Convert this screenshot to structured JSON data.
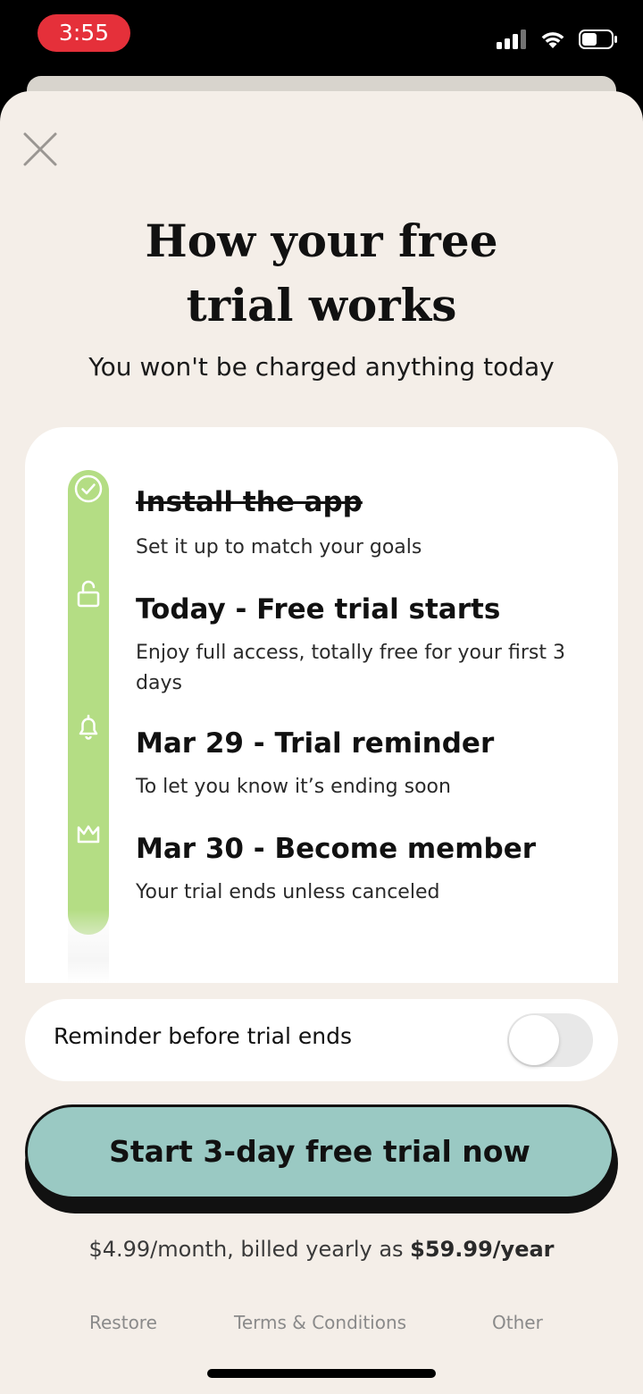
{
  "status_bar": {
    "time": "3:55"
  },
  "header": {
    "title_line1": "How your free",
    "title_line2": "trial works",
    "subtitle": "You won't be charged anything today"
  },
  "timeline": {
    "steps": [
      {
        "title": "Install the app",
        "description": "Set it up to match your goals",
        "icon": "check-circle-icon",
        "completed": true
      },
      {
        "title": "Today - Free trial starts",
        "description": "Enjoy full access, totally free for your first 3 days",
        "icon": "unlock-icon",
        "completed": false
      },
      {
        "title": "Mar 29 - Trial reminder",
        "description": "To let you know it’s ending soon",
        "icon": "bell-icon",
        "completed": false
      },
      {
        "title": "Mar 30 - Become member",
        "description": "Your trial ends unless canceled",
        "icon": "crown-icon",
        "completed": false
      }
    ]
  },
  "reminder": {
    "label": "Reminder before trial ends",
    "enabled": false
  },
  "cta": {
    "label": "Start 3-day free trial now"
  },
  "pricing": {
    "prefix": "$4.99/month, billed yearly as ",
    "yearly": "$59.99/year"
  },
  "footer": {
    "restore": "Restore",
    "terms": "Terms & Conditions",
    "other": "Other"
  },
  "colors": {
    "sheet_background": "#f4eee8",
    "timeline_accent": "#b4dd84",
    "cta_background": "#9ac9c3",
    "time_pill": "#e5303a"
  }
}
